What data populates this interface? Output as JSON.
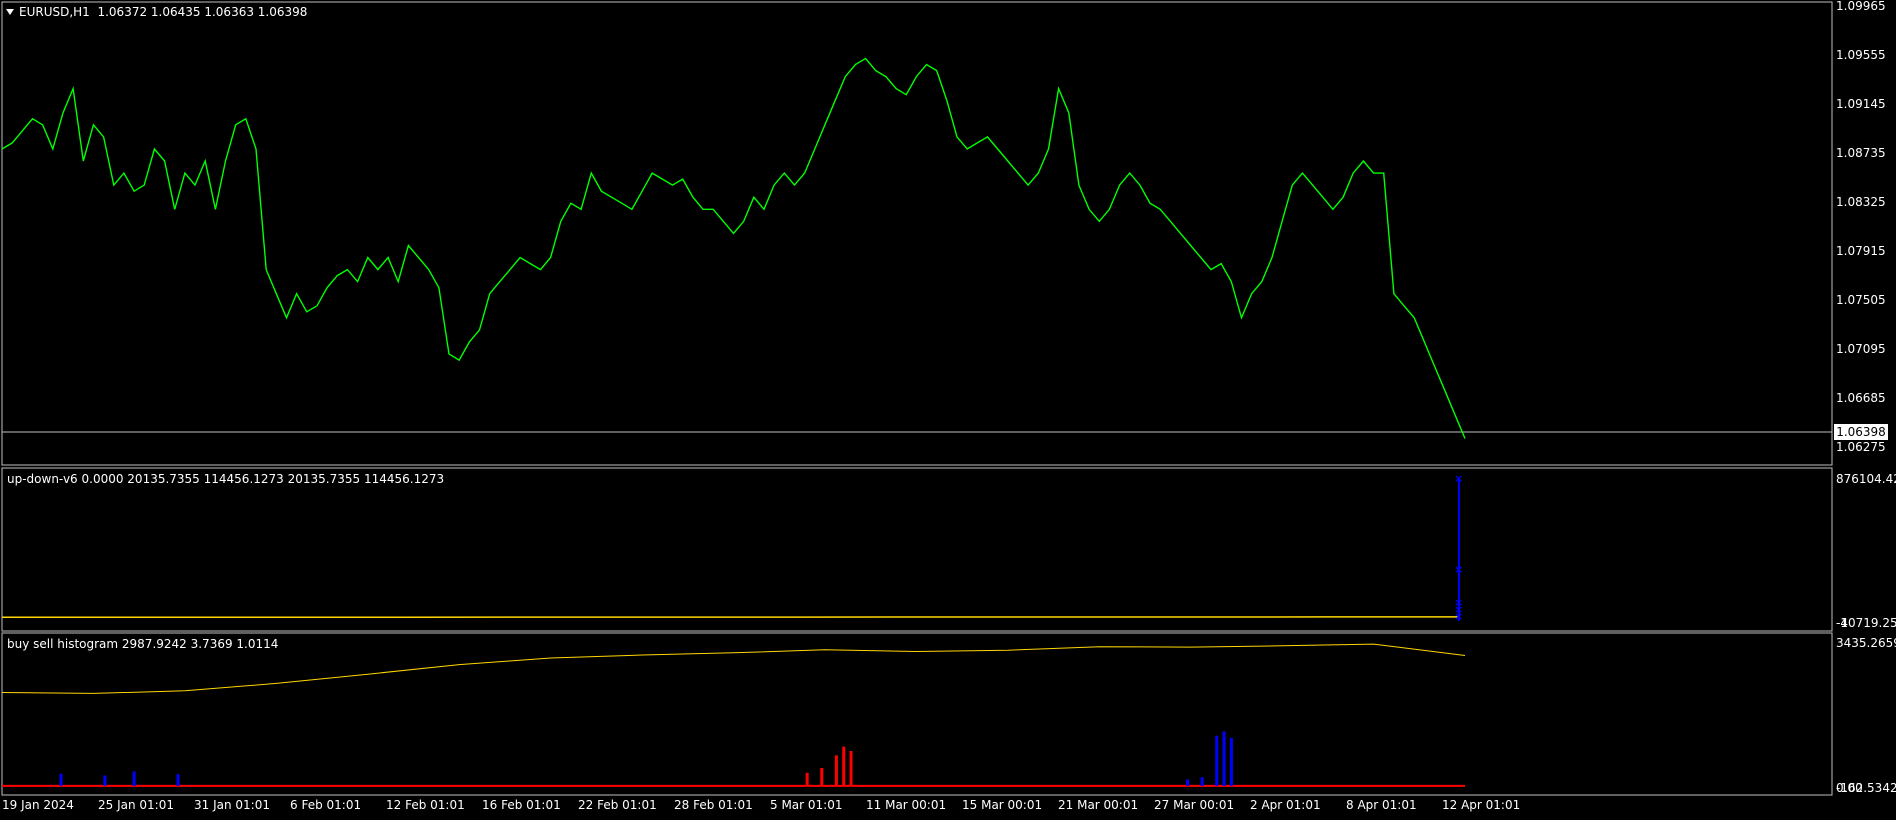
{
  "main": {
    "symbol": "EURUSD,H1",
    "ohlc": "1.06372 1.06435 1.06363 1.06398",
    "current_price": "1.06398",
    "y_ticks": [
      "1.09965",
      "1.09555",
      "1.09145",
      "1.08735",
      "1.08325",
      "1.07915",
      "1.07505",
      "1.07095",
      "1.06685",
      "1.06275"
    ]
  },
  "ind1": {
    "label": "up-down-v6 0.0000 20135.7355 114456.1273 20135.7355 114456.1273",
    "y_ticks": [
      "876104.42",
      "-1",
      "-40719.258"
    ]
  },
  "ind2": {
    "label": "buy sell histogram 2987.9242 3.7369 1.0114",
    "y_ticks": [
      "3435.2659",
      "0.00",
      "-162.5342"
    ]
  },
  "x_ticks": [
    "19 Jan 2024",
    "25 Jan 01:01",
    "31 Jan 01:01",
    "6 Feb 01:01",
    "12 Feb 01:01",
    "16 Feb 01:01",
    "22 Feb 01:01",
    "28 Feb 01:01",
    "5 Mar 01:01",
    "11 Mar 00:01",
    "15 Mar 00:01",
    "21 Mar 00:01",
    "27 Mar 00:01",
    "2 Apr 01:01",
    "8 Apr 01:01",
    "12 Apr 01:01"
  ],
  "colors": {
    "price": "#00ff00",
    "ma": "#ffd700",
    "up": "#0000ff",
    "down": "#ff0000",
    "grid": "#c0c0c0"
  },
  "chart_data": [
    {
      "type": "line",
      "title": "EURUSD,H1",
      "ylim": [
        1.0618,
        1.1001
      ],
      "series": [
        {
          "values": [
            1.088,
            1.0885,
            1.0895,
            1.0905,
            1.09,
            1.088,
            1.091,
            1.093,
            1.087,
            1.09,
            1.089,
            1.085,
            1.086,
            1.0845,
            1.085,
            1.088,
            1.087,
            1.083,
            1.086,
            1.085,
            1.087,
            1.083,
            1.087,
            1.09,
            1.0905,
            1.088,
            1.078,
            1.076,
            1.074,
            1.076,
            1.0745,
            1.075,
            1.0765,
            1.0775,
            1.078,
            1.077,
            1.079,
            1.078,
            1.079,
            1.077,
            1.08,
            1.079,
            1.078,
            1.0765,
            1.071,
            1.0705,
            1.072,
            1.073,
            1.076,
            1.077,
            1.078,
            1.079,
            1.0785,
            1.078,
            1.079,
            1.082,
            1.0835,
            1.083,
            1.086,
            1.0845,
            1.084,
            1.0835,
            1.083,
            1.0845,
            1.086,
            1.0855,
            1.085,
            1.0855,
            1.084,
            1.083,
            1.083,
            1.082,
            1.081,
            1.082,
            1.084,
            1.083,
            1.085,
            1.086,
            1.085,
            1.086,
            1.088,
            1.09,
            1.092,
            1.094,
            1.095,
            1.0955,
            1.0945,
            1.094,
            1.093,
            1.0925,
            1.094,
            1.095,
            1.0945,
            1.092,
            1.089,
            1.088,
            1.0885,
            1.089,
            1.088,
            1.087,
            1.086,
            1.085,
            1.086,
            1.088,
            1.093,
            1.091,
            1.085,
            1.083,
            1.082,
            1.083,
            1.085,
            1.086,
            1.085,
            1.0835,
            1.083,
            1.082,
            1.081,
            1.08,
            1.079,
            1.078,
            1.0785,
            1.077,
            1.074,
            1.076,
            1.077,
            1.079,
            1.082,
            1.085,
            1.086,
            1.085,
            1.084,
            1.083,
            1.084,
            1.086,
            1.087,
            1.086,
            1.086,
            1.076,
            1.075,
            1.074,
            1.072,
            1.07,
            1.068,
            1.066,
            1.064
          ]
        }
      ]
    },
    {
      "type": "line",
      "title": "up-down-v6",
      "ylim": [
        -40719.258,
        876104.42
      ],
      "series": [
        {
          "name": "up-down-v6",
          "values": [
            5000,
            5200,
            5400,
            5600,
            5800,
            6000,
            6200,
            6400,
            6600,
            6800,
            7000,
            7200
          ]
        }
      ]
    },
    {
      "type": "bar",
      "title": "buy sell histogram",
      "ylim": [
        -162.5342,
        3435.2659
      ],
      "x": [
        0.04,
        0.07,
        0.09,
        0.12,
        0.55,
        0.56,
        0.57,
        0.575,
        0.58,
        0.81,
        0.82,
        0.83,
        0.835,
        0.84
      ],
      "series": [
        {
          "name": "buy",
          "values": [
            280,
            240,
            330,
            270,
            0,
            0,
            0,
            0,
            0,
            150,
            200,
            1150,
            1250,
            1100
          ]
        },
        {
          "name": "sell",
          "values": [
            0,
            0,
            0,
            0,
            300,
            410,
            700,
            900,
            800,
            0,
            0,
            0,
            0,
            0
          ]
        }
      ],
      "line": [
        2140,
        2120,
        2180,
        2350,
        2560,
        2780,
        2930,
        3000,
        3050,
        3120,
        3080,
        3110,
        3190,
        3180,
        3210,
        3250,
        2987.92
      ]
    }
  ]
}
